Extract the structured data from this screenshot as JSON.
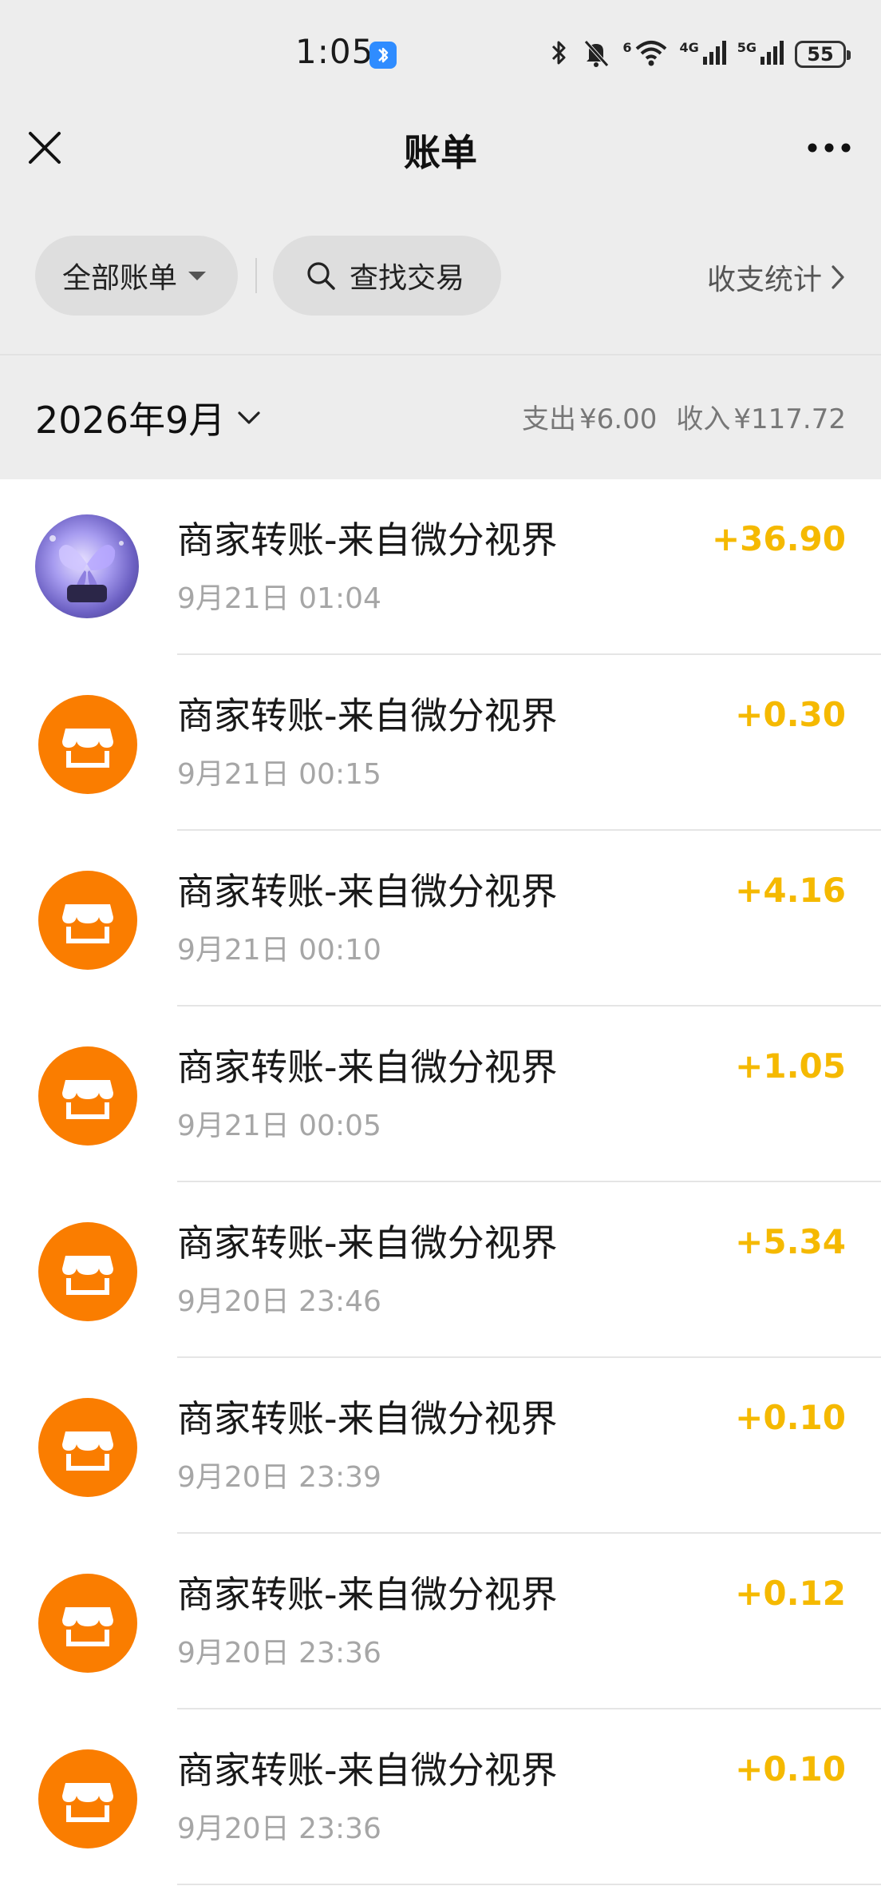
{
  "status_bar": {
    "time": "1:05",
    "battery": "55",
    "network_1": "6",
    "network_2": "4G",
    "network_3": "5G"
  },
  "nav": {
    "title": "账单",
    "close_icon": "close-icon",
    "more_icon": "more-icon"
  },
  "filters": {
    "all_bills": "全部账单",
    "search": "查找交易",
    "stats": "收支统计"
  },
  "month": {
    "label": "2026年9月",
    "expense_label": "支出",
    "expense_amount": "¥6.00",
    "income_label": "收入",
    "income_amount": "¥117.72"
  },
  "colors": {
    "amount": "#f5b900",
    "store_icon_bg": "#fa7d00",
    "header_bg": "#ededed"
  },
  "transactions": [
    {
      "title": "商家转账-来自微分视界",
      "time": "9月21日 01:04",
      "amount": "+36.90",
      "icon": "merchant-avatar-photo"
    },
    {
      "title": "商家转账-来自微分视界",
      "time": "9月21日 00:15",
      "amount": "+0.30",
      "icon": "store-icon"
    },
    {
      "title": "商家转账-来自微分视界",
      "time": "9月21日 00:10",
      "amount": "+4.16",
      "icon": "store-icon"
    },
    {
      "title": "商家转账-来自微分视界",
      "time": "9月21日 00:05",
      "amount": "+1.05",
      "icon": "store-icon"
    },
    {
      "title": "商家转账-来自微分视界",
      "time": "9月20日 23:46",
      "amount": "+5.34",
      "icon": "store-icon"
    },
    {
      "title": "商家转账-来自微分视界",
      "time": "9月20日 23:39",
      "amount": "+0.10",
      "icon": "store-icon"
    },
    {
      "title": "商家转账-来自微分视界",
      "time": "9月20日 23:36",
      "amount": "+0.12",
      "icon": "store-icon"
    },
    {
      "title": "商家转账-来自微分视界",
      "time": "9月20日 23:36",
      "amount": "+0.10",
      "icon": "store-icon"
    }
  ]
}
